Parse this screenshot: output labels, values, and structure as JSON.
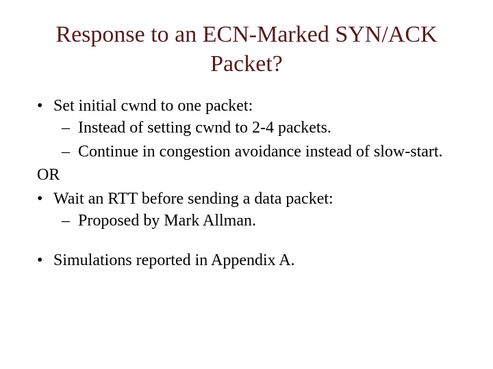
{
  "title": "Response to an ECN-Marked SYN/ACK Packet?",
  "bullets": {
    "b1": "Set initial cwnd to one packet:",
    "b1_s1": "Instead of setting cwnd to 2-4 packets.",
    "b1_s2": "Continue in congestion avoidance instead of slow-start.",
    "or": "OR",
    "b2": "Wait an RTT before sending a data packet:",
    "b2_s1": "Proposed by Mark Allman.",
    "b3": "Simulations reported in Appendix A."
  }
}
